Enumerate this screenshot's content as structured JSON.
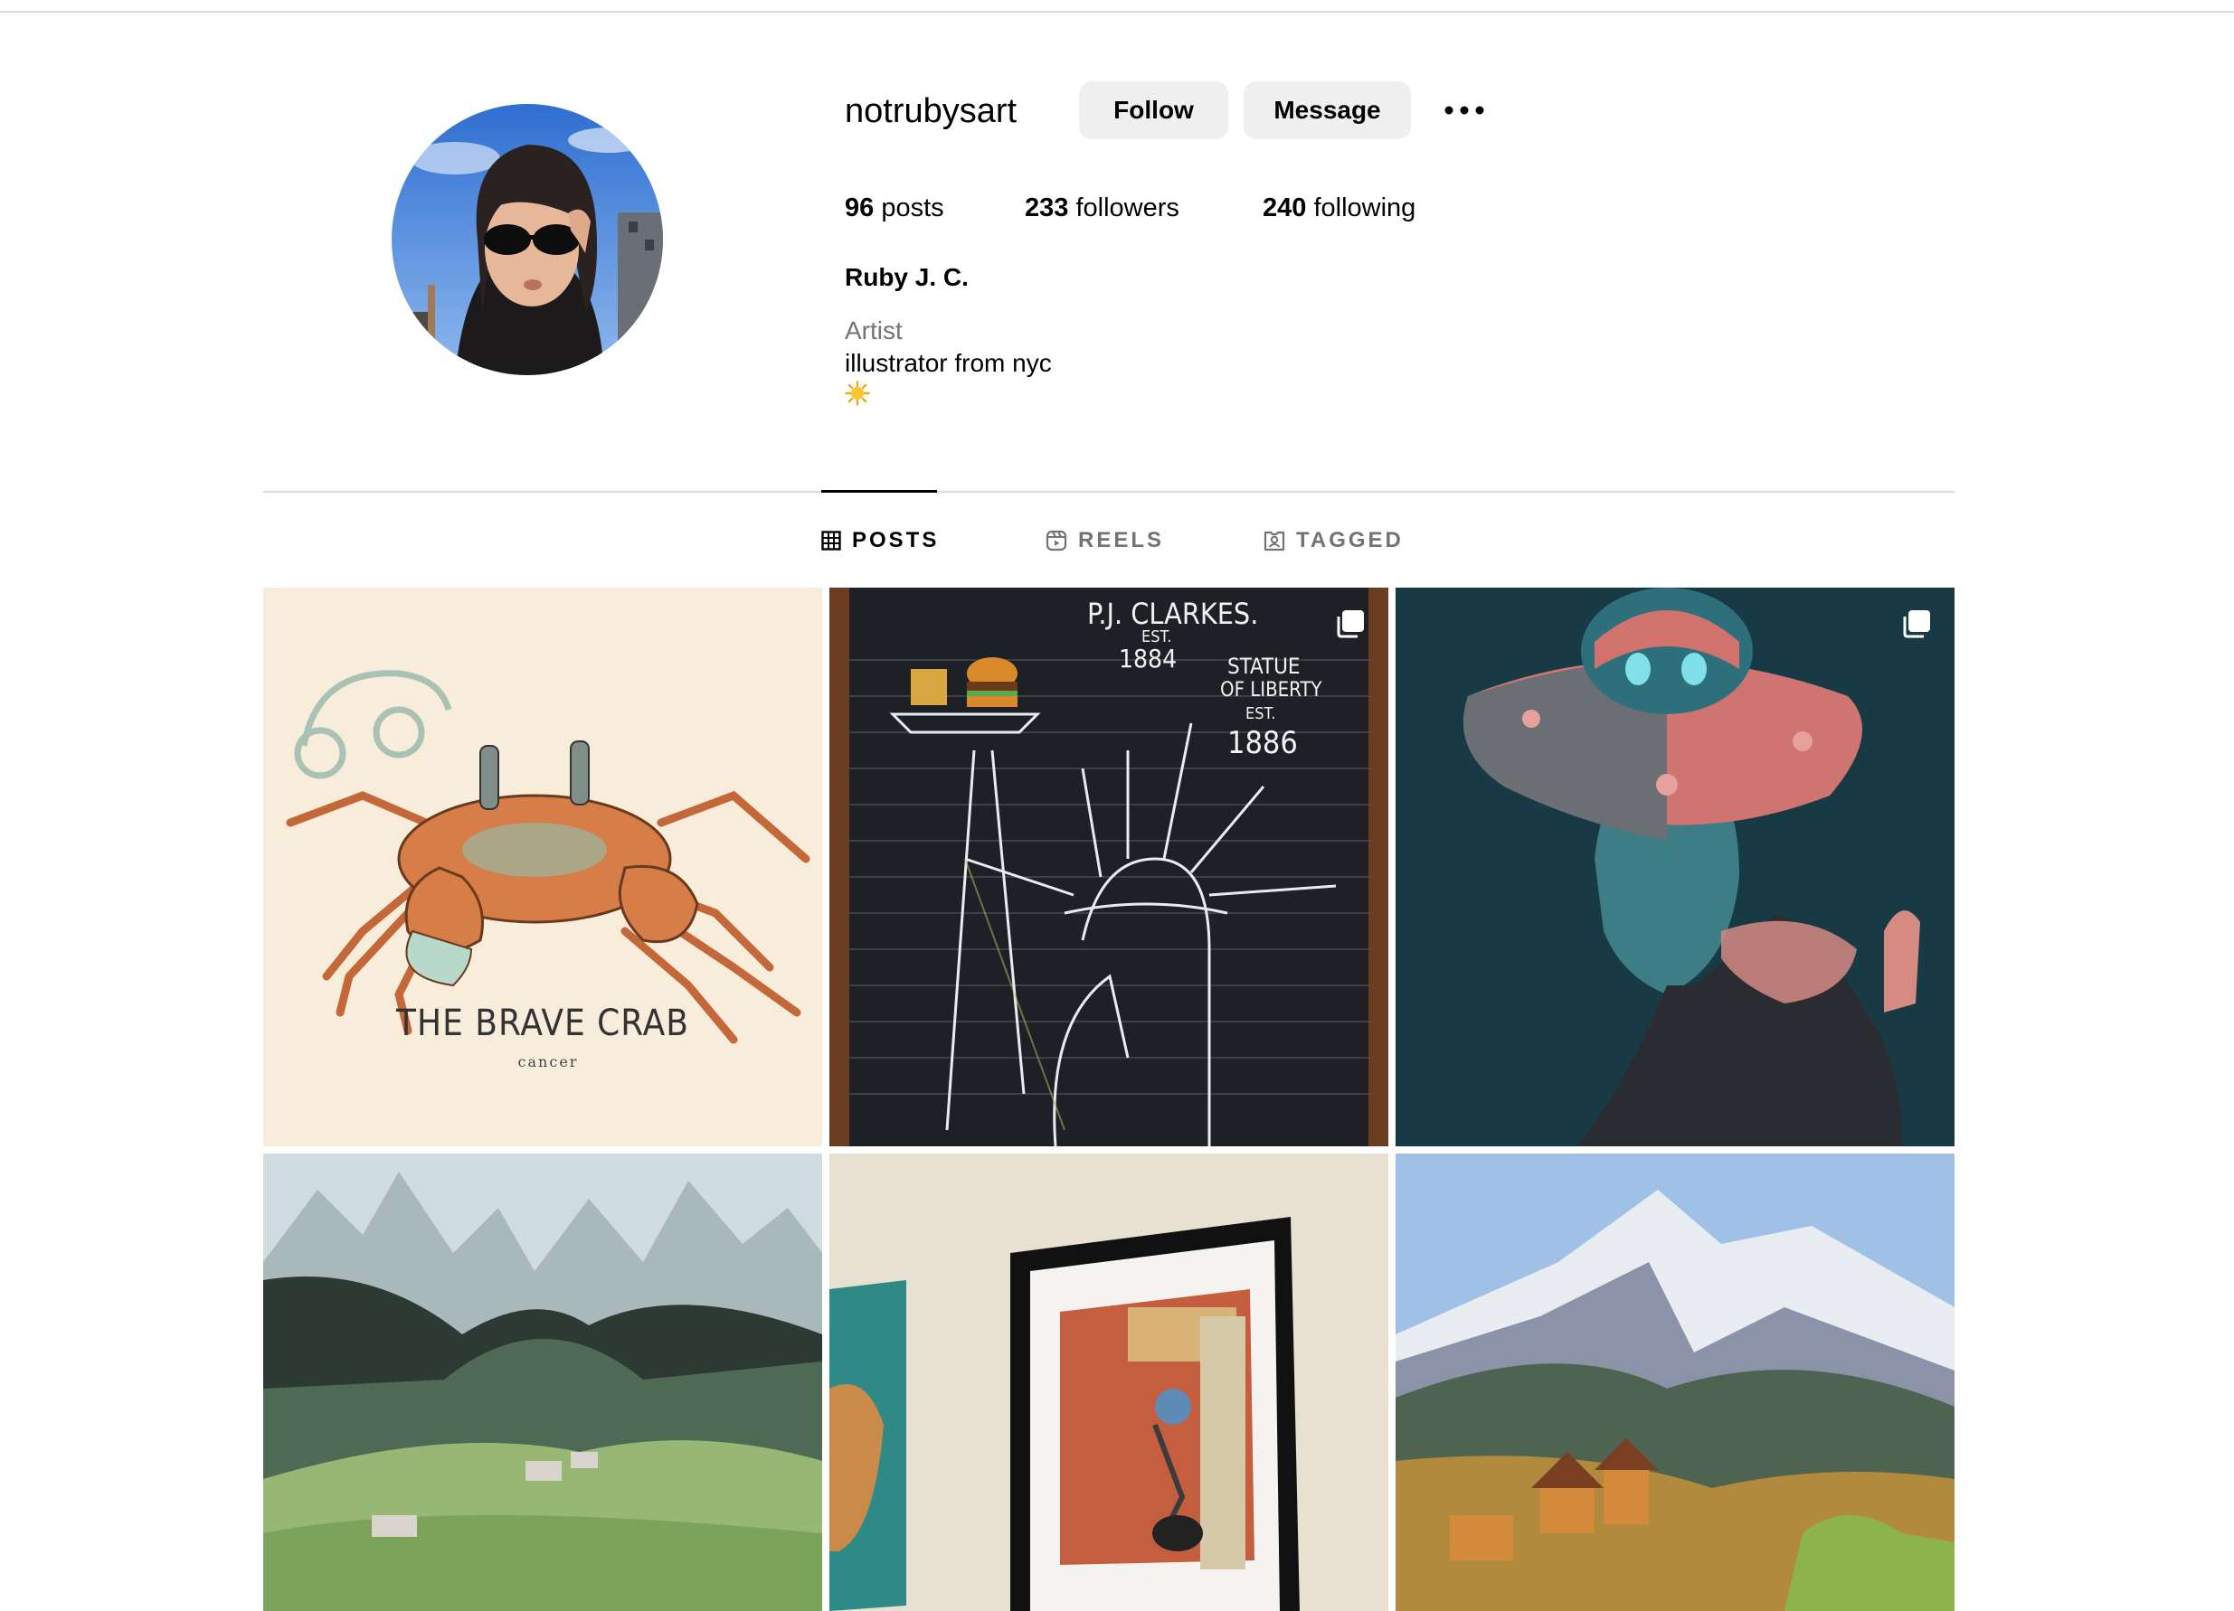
{
  "profile": {
    "username": "notrubysart",
    "follow_label": "Follow",
    "message_label": "Message",
    "stats": {
      "posts_count": "96",
      "posts_label": "posts",
      "followers_count": "233",
      "followers_label": "followers",
      "following_count": "240",
      "following_label": "following"
    },
    "full_name": "Ruby J. C.",
    "category": "Artist",
    "bio": "illustrator from nyc",
    "bio_emoji": "sun-emoji"
  },
  "tabs": [
    {
      "label": "POSTS",
      "icon": "grid-icon",
      "active": true
    },
    {
      "label": "REELS",
      "icon": "reels-icon",
      "active": false
    },
    {
      "label": "TAGGED",
      "icon": "tagged-icon",
      "active": false
    }
  ],
  "posts": [
    {
      "subject": "crab illustration",
      "caption_title": "THE BRAVE CRAB",
      "caption_sub": "cancer",
      "multiple": false
    },
    {
      "subject": "chalkboard statue of liberty",
      "text_pj": "P.J. CLARKES.",
      "text_est1": "EST.",
      "text_year1": "1884",
      "text_statue1": "STATUE",
      "text_statue2": "OF LIBERTY",
      "text_est2": "EST.",
      "text_year2": "1886",
      "multiple": true
    },
    {
      "subject": "woman with ufo hat",
      "multiple": true
    },
    {
      "subject": "green mountain valley painting",
      "multiple": false
    },
    {
      "subject": "framed city illustration on wall",
      "multiple": false
    },
    {
      "subject": "snowy mountain village painting",
      "multiple": false
    }
  ],
  "colors": {
    "button_bg": "#efefef",
    "secondary_text": "#737373",
    "divider": "#dbdbdb"
  }
}
